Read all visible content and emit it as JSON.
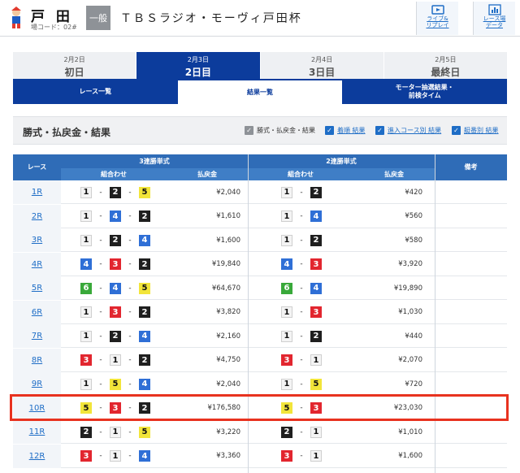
{
  "header": {
    "venue": "戸 田",
    "venue_code": "場コード：02#",
    "grade": "一般",
    "race_title": "ＴＢＳラジオ・モーヴィ戸田杯",
    "buttons": [
      {
        "label1": "ライブ&",
        "label2": "リプレイ",
        "icon": "tv-icon"
      },
      {
        "label1": "レース場",
        "label2": "データ",
        "icon": "chart-icon"
      }
    ]
  },
  "day_tabs": [
    {
      "date": "2月2日",
      "label": "初日",
      "active": false
    },
    {
      "date": "2月3日",
      "label": "2日目",
      "active": true
    },
    {
      "date": "2月4日",
      "label": "3日目",
      "active": false
    },
    {
      "date": "2月5日",
      "label": "最終日",
      "active": false
    }
  ],
  "sub_tabs": [
    {
      "label": "レース一覧",
      "active": false
    },
    {
      "label": "結果一覧",
      "active": true
    },
    {
      "label": "モーター抽選結果・",
      "label2": "前検タイム",
      "active": false
    }
  ],
  "results_bar": {
    "title": "勝式・払戻金・結果",
    "checks": [
      {
        "label": "勝式・払戻金・結果",
        "link": false
      },
      {
        "label": "着順 結果",
        "link": true
      },
      {
        "label": "進入コース別 結果",
        "link": true
      },
      {
        "label": "艇番別 結果",
        "link": true
      }
    ]
  },
  "table": {
    "col_race": "レース",
    "col_trifecta": "3連勝単式",
    "col_exacta": "2連勝単式",
    "col_note": "備考",
    "sub_combo": "組合わせ",
    "sub_payout": "払戻金",
    "rows": [
      {
        "race": "1R",
        "tri": [
          1,
          2,
          5
        ],
        "tri_pay": "¥2,040",
        "ex": [
          1,
          2
        ],
        "ex_pay": "¥420"
      },
      {
        "race": "2R",
        "tri": [
          1,
          4,
          2
        ],
        "tri_pay": "¥1,610",
        "ex": [
          1,
          4
        ],
        "ex_pay": "¥560"
      },
      {
        "race": "3R",
        "tri": [
          1,
          2,
          4
        ],
        "tri_pay": "¥1,600",
        "ex": [
          1,
          2
        ],
        "ex_pay": "¥580"
      },
      {
        "race": "4R",
        "tri": [
          4,
          3,
          2
        ],
        "tri_pay": "¥19,840",
        "ex": [
          4,
          3
        ],
        "ex_pay": "¥3,920"
      },
      {
        "race": "5R",
        "tri": [
          6,
          4,
          5
        ],
        "tri_pay": "¥64,670",
        "ex": [
          6,
          4
        ],
        "ex_pay": "¥19,890"
      },
      {
        "race": "6R",
        "tri": [
          1,
          3,
          2
        ],
        "tri_pay": "¥3,820",
        "ex": [
          1,
          3
        ],
        "ex_pay": "¥1,030"
      },
      {
        "race": "7R",
        "tri": [
          1,
          2,
          4
        ],
        "tri_pay": "¥2,160",
        "ex": [
          1,
          2
        ],
        "ex_pay": "¥440"
      },
      {
        "race": "8R",
        "tri": [
          3,
          1,
          2
        ],
        "tri_pay": "¥4,750",
        "ex": [
          3,
          1
        ],
        "ex_pay": "¥2,070"
      },
      {
        "race": "9R",
        "tri": [
          1,
          5,
          4
        ],
        "tri_pay": "¥2,040",
        "ex": [
          1,
          5
        ],
        "ex_pay": "¥720"
      },
      {
        "race": "10R",
        "tri": [
          5,
          3,
          2
        ],
        "tri_pay": "¥176,580",
        "ex": [
          5,
          3
        ],
        "ex_pay": "¥23,030",
        "highlight": true
      },
      {
        "race": "11R",
        "tri": [
          2,
          1,
          5
        ],
        "tri_pay": "¥3,220",
        "ex": [
          2,
          1
        ],
        "ex_pay": "¥1,010"
      },
      {
        "race": "12R",
        "tri": [
          3,
          1,
          4
        ],
        "tri_pay": "¥3,360",
        "ex": [
          3,
          1
        ],
        "ex_pay": "¥1,600"
      }
    ]
  },
  "colors": {
    "navy": "#0c3c9c",
    "header_blue": "#2f6cb7",
    "highlight": "#e8321f"
  }
}
